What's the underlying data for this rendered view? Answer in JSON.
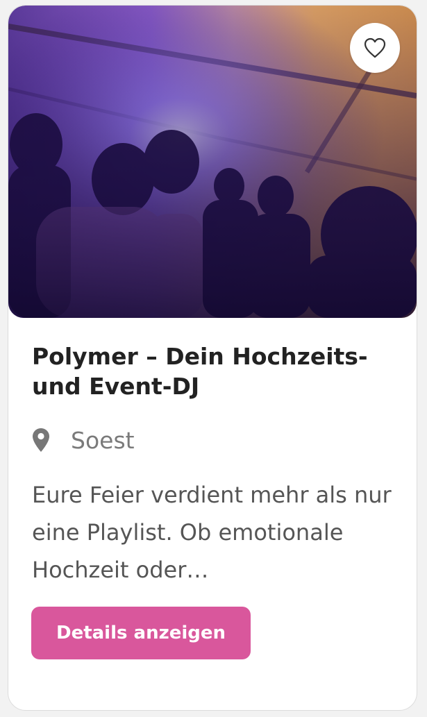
{
  "listing": {
    "title": "Polymer – Dein Hochzeits- und Event-DJ",
    "location": "Soest",
    "description": "Eure Feier verdient mehr als nur eine Playlist. Ob emotionale Hochzeit oder…",
    "details_label": "Details anzeigen",
    "image_alt": "Party im Festzelt"
  },
  "icons": {
    "favorite": "heart-outline-icon",
    "location": "map-pin-icon"
  },
  "colors": {
    "accent": "#d9579c",
    "title": "#222222",
    "muted": "#7a7a7a",
    "text": "#555555"
  }
}
